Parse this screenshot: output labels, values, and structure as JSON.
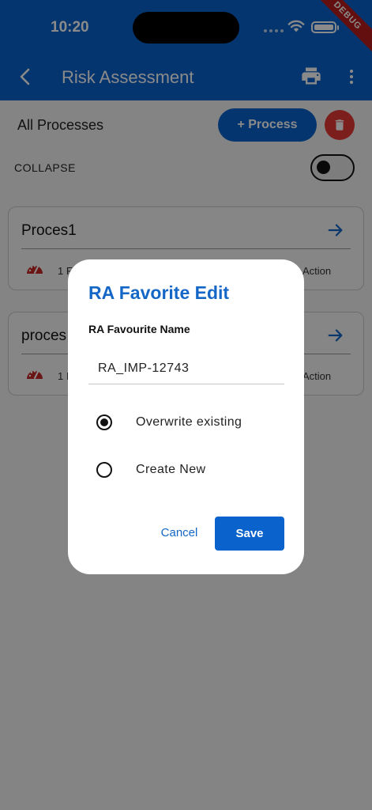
{
  "status_bar": {
    "time": "10:20",
    "debug_banner": "DEBUG"
  },
  "app_bar": {
    "title": "Risk Assessment",
    "icons": [
      "back-arrow-icon",
      "print-icon",
      "more-vert-icon"
    ]
  },
  "header": {
    "all_processes_label": "All Processes",
    "add_process_label": "+ Process",
    "collapse_label": "COLLAPSE",
    "collapse_toggle_on": false
  },
  "process_cards": [
    {
      "title": "Proces1",
      "count_text": "1 F",
      "action_text": "Action"
    },
    {
      "title": "proces",
      "count_text": "1 I",
      "action_text": "Action"
    }
  ],
  "dialog": {
    "title": "RA Favorite Edit",
    "field_label": "RA Favourite Name",
    "field_value": "RA_IMP-12743",
    "options": [
      {
        "label": "Overwrite existing",
        "selected": true
      },
      {
        "label": "Create New",
        "selected": false
      }
    ],
    "cancel_label": "Cancel",
    "save_label": "Save"
  },
  "colors": {
    "primary": "#0a63cc",
    "title_blue": "#1467c6",
    "danger": "#e53935",
    "debug_red": "#b71c1c"
  }
}
